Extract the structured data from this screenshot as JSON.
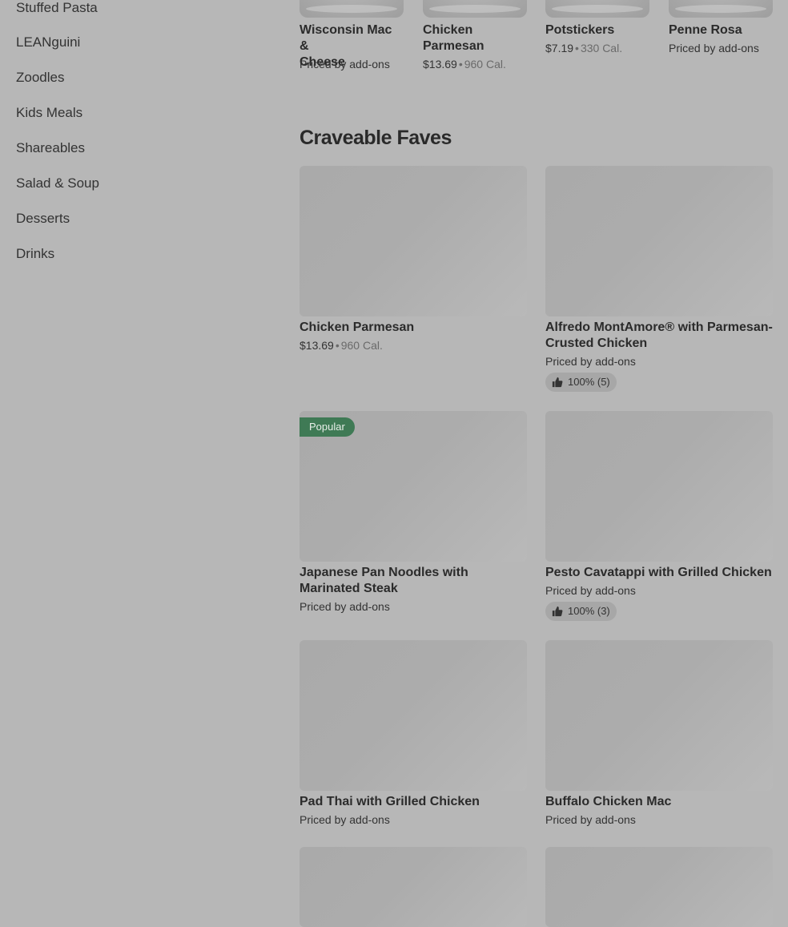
{
  "sidebar": {
    "items": [
      {
        "label": "Stuffed Pasta"
      },
      {
        "label": "LEANguini"
      },
      {
        "label": "Zoodles"
      },
      {
        "label": "Kids Meals"
      },
      {
        "label": "Shareables"
      },
      {
        "label": "Salad & Soup"
      },
      {
        "label": "Desserts"
      },
      {
        "label": "Drinks"
      }
    ]
  },
  "top_row": [
    {
      "name_line1": "Wisconsin Mac &",
      "name_line2": "Cheese",
      "meta": "Priced by add-ons"
    },
    {
      "name_line1": "Chicken",
      "name_line2": "Parmesan",
      "price": "$13.69",
      "sep": "•",
      "calories": "960 Cal."
    },
    {
      "name_line1": "Potstickers",
      "price": "$7.19",
      "sep": "•",
      "calories": "330 Cal."
    },
    {
      "name_line1": "Penne Rosa",
      "meta": "Priced by add-ons"
    }
  ],
  "section": {
    "title": "Craveable Faves"
  },
  "cards": [
    {
      "name": "Chicken Parmesan",
      "price": "$13.69",
      "sep": "•",
      "calories": "960 Cal."
    },
    {
      "name": "Alfredo MontAmore® with Parmesan-Crusted Chicken",
      "meta": "Priced by add-ons",
      "rating": "100% (5)"
    },
    {
      "name": "Japanese Pan Noodles with Marinated Steak",
      "meta": "Priced by add-ons",
      "badge": "Popular"
    },
    {
      "name": "Pesto Cavatappi with Grilled Chicken",
      "meta": "Priced by add-ons",
      "rating": "100% (3)"
    },
    {
      "name": "Pad Thai with Grilled Chicken",
      "meta": "Priced by add-ons"
    },
    {
      "name": "Buffalo Chicken Mac",
      "meta": "Priced by add-ons"
    }
  ],
  "icons": {
    "rating": "thumbs-up-icon"
  }
}
